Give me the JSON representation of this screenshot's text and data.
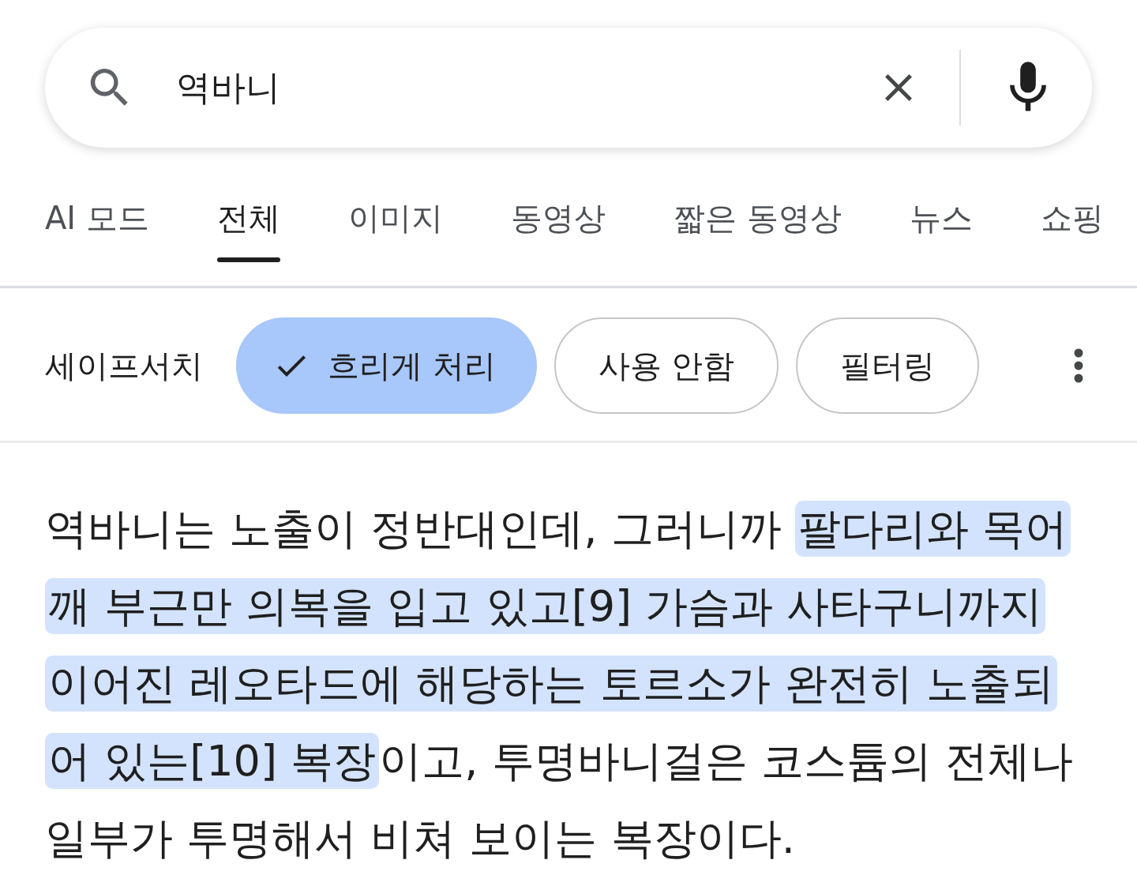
{
  "search": {
    "value": "역바니"
  },
  "tabs": [
    {
      "label": "AI 모드",
      "selected": false
    },
    {
      "label": "전체",
      "selected": true
    },
    {
      "label": "이미지",
      "selected": false
    },
    {
      "label": "동영상",
      "selected": false
    },
    {
      "label": "짧은 동영상",
      "selected": false
    },
    {
      "label": "뉴스",
      "selected": false
    },
    {
      "label": "쇼핑",
      "selected": false
    }
  ],
  "safesearch": {
    "label": "세이프서치",
    "options": [
      {
        "label": "흐리게 처리",
        "selected": true
      },
      {
        "label": "사용 안함",
        "selected": false
      },
      {
        "label": "필터링",
        "selected": false
      }
    ]
  },
  "snippet": {
    "before": "역바니는 노출이 정반대인데, 그러니까 ",
    "highlighted": "팔다리와 목어깨 부근만 의복을 입고 있고[9] 가슴과 사타구니까지 이어진 레오타드에 해당하는 토르소가 완전히 노출되어 있는[10] 복장",
    "after": "이고, 투명바니걸은 코스튬의 전체나 일부가 투명해서 비쳐 보이는 복장이다."
  }
}
